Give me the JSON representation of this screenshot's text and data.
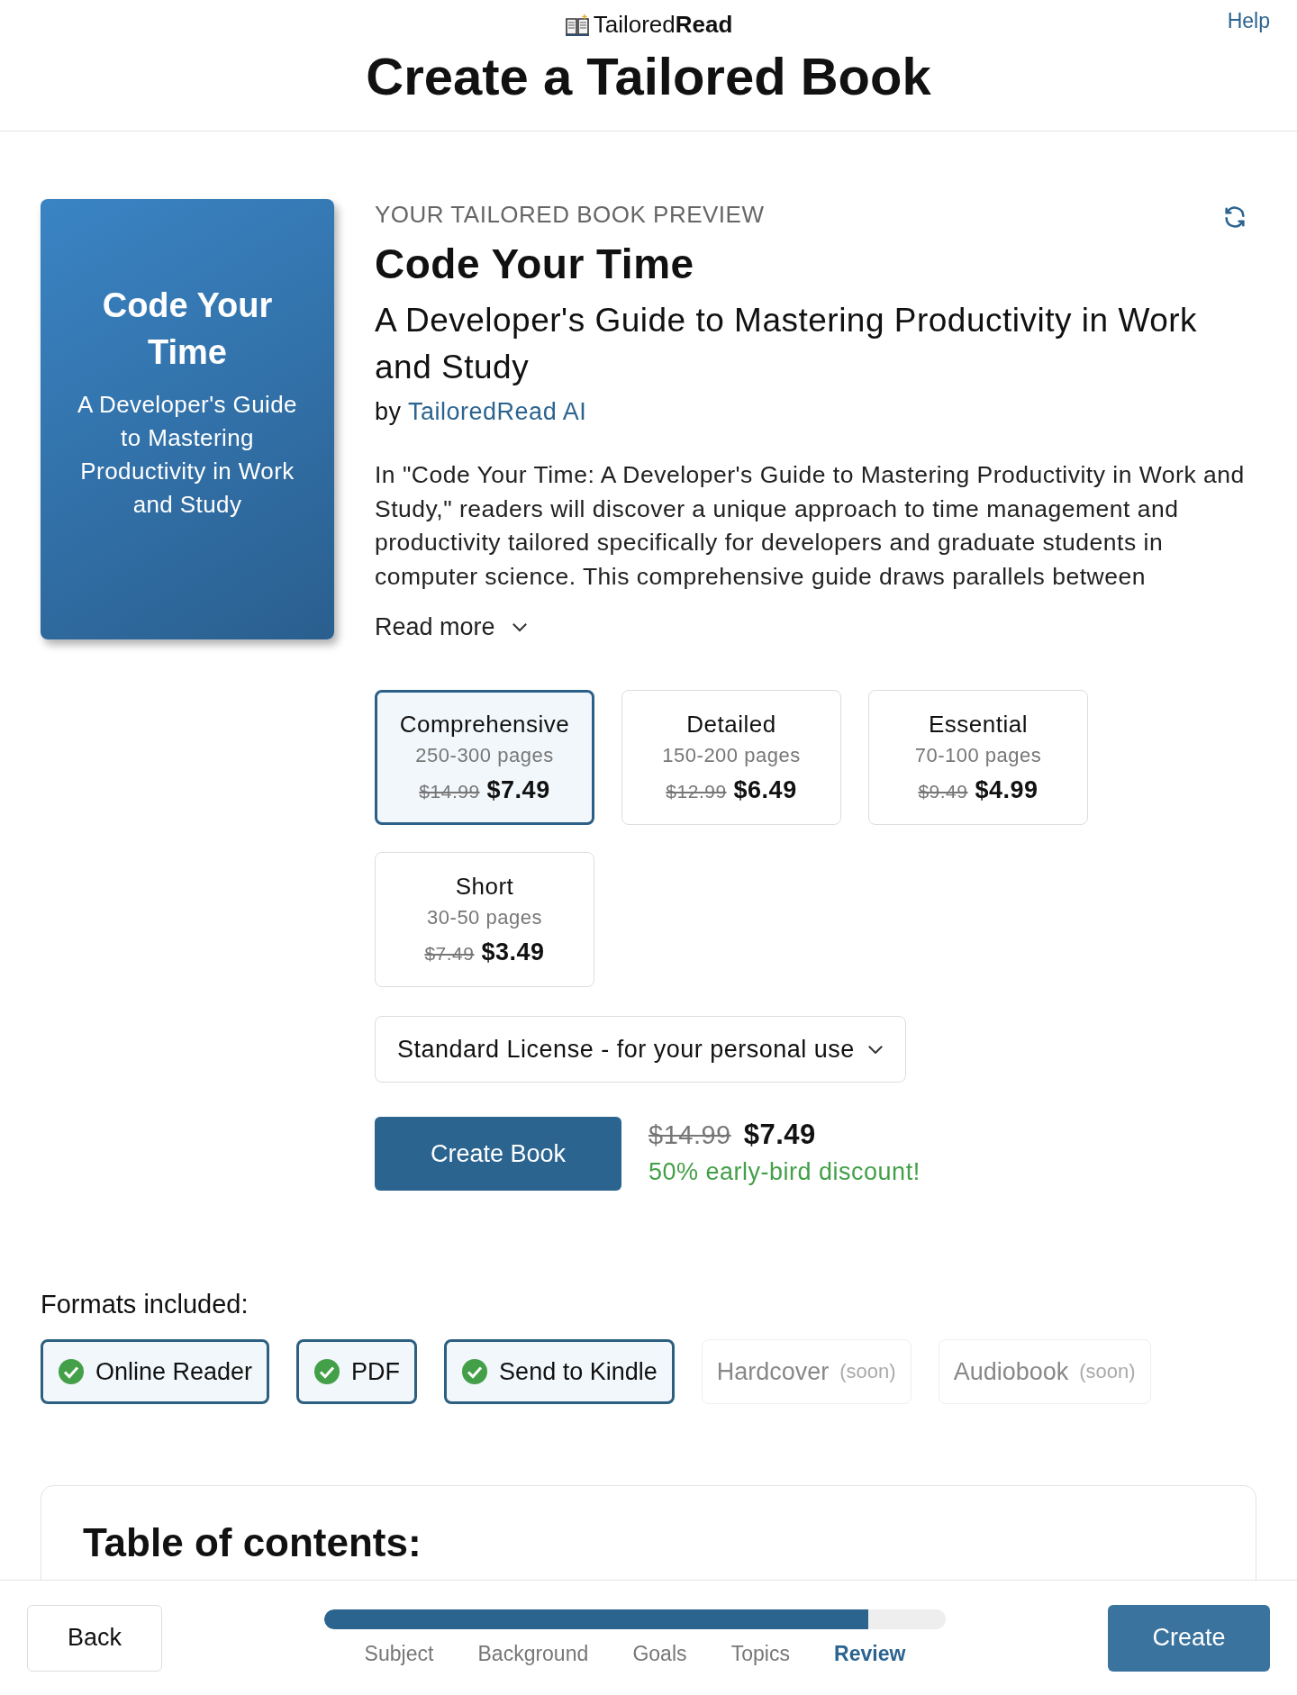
{
  "header": {
    "logo_text": "Tailored",
    "logo_bold": "Read",
    "help": "Help",
    "title": "Create a Tailored Book"
  },
  "cover": {
    "title": "Code Your Time",
    "subtitle": "A Developer's Guide to Mastering Productivity in Work and Study"
  },
  "preview": {
    "label": "YOUR TAILORED BOOK PREVIEW",
    "title": "Code Your Time",
    "subtitle": "A Developer's Guide to Mastering Productivity in Work and Study",
    "by": "by",
    "author": "TailoredRead AI",
    "description": "In \"Code Your Time: A Developer's Guide to Mastering Productivity in Work and Study,\" readers will discover a unique approach to time management and productivity tailored specifically for developers and graduate students in computer science. This comprehensive guide draws parallels between",
    "read_more": "Read more"
  },
  "options": [
    {
      "name": "Comprehensive",
      "pages": "250-300 pages",
      "old_price": "$14.99",
      "price": "$7.49",
      "selected": true
    },
    {
      "name": "Detailed",
      "pages": "150-200 pages",
      "old_price": "$12.99",
      "price": "$6.49",
      "selected": false
    },
    {
      "name": "Essential",
      "pages": "70-100 pages",
      "old_price": "$9.49",
      "price": "$4.99",
      "selected": false
    },
    {
      "name": "Short",
      "pages": "30-50 pages",
      "old_price": "$7.49",
      "price": "$3.49",
      "selected": false
    }
  ],
  "license": {
    "value": "Standard License - for your personal use"
  },
  "purchase": {
    "button": "Create Book",
    "old_price": "$14.99",
    "price": "$7.49",
    "discount": "50% early-bird discount!"
  },
  "formats": {
    "title": "Formats included:",
    "items": [
      {
        "label": "Online Reader",
        "checked": true
      },
      {
        "label": "PDF",
        "checked": true
      },
      {
        "label": "Send to Kindle",
        "checked": true
      },
      {
        "label": "Hardcover",
        "note": "(soon)",
        "checked": false
      },
      {
        "label": "Audiobook",
        "note": "(soon)",
        "checked": false
      }
    ]
  },
  "toc": {
    "title": "Table of contents:"
  },
  "footer": {
    "back": "Back",
    "create": "Create",
    "progress": {
      "level": 0.875
    },
    "steps": [
      {
        "label": "Subject",
        "selected": false
      },
      {
        "label": "Background",
        "selected": false
      },
      {
        "label": "Goals",
        "selected": false
      },
      {
        "label": "Topics",
        "selected": false
      },
      {
        "label": "Review",
        "selected": true
      }
    ]
  }
}
